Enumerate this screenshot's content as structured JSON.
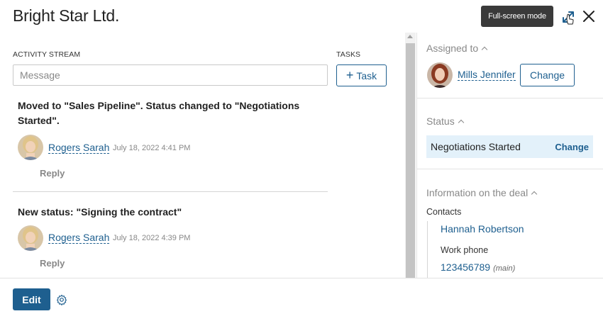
{
  "header": {
    "title": "Bright Star Ltd.",
    "tooltip": "Full-screen mode",
    "icons": {
      "fullscreen": "expand-arrows-icon",
      "close": "close-icon"
    }
  },
  "activity": {
    "section_label": "ACTIVITY STREAM",
    "message_placeholder": "Message",
    "tasks_label": "TASKS",
    "task_button_plus": "+",
    "task_button_label": "Task",
    "reply_label": "Reply",
    "items": [
      {
        "text": "Moved to \"Sales Pipeline\". Status changed to \"Negotiations Started\".",
        "author": "Rogers Sarah",
        "timestamp": "July 18, 2022 4:41 PM"
      },
      {
        "text": "New status: \"Signing the contract\"",
        "author": "Rogers Sarah",
        "timestamp": "July 18, 2022 4:39 PM"
      }
    ]
  },
  "sidebar": {
    "assigned_heading": "Assigned to",
    "assignee": "Mills Jennifer",
    "change_label": "Change",
    "status_heading": "Status",
    "status_value": "Negotiations Started",
    "status_change": "Change",
    "info_heading": "Information on the deal",
    "contacts_label": "Contacts",
    "contact_name": "Hannah Robertson",
    "work_phone_label": "Work phone",
    "phone": "123456789",
    "phone_note": "(main)"
  },
  "footer": {
    "edit_label": "Edit",
    "settings_icon": "gear-icon"
  },
  "colors": {
    "accent": "#1e5f8f",
    "status_bg": "#e3f1fa",
    "tooltip_bg": "#3a3a3a"
  }
}
